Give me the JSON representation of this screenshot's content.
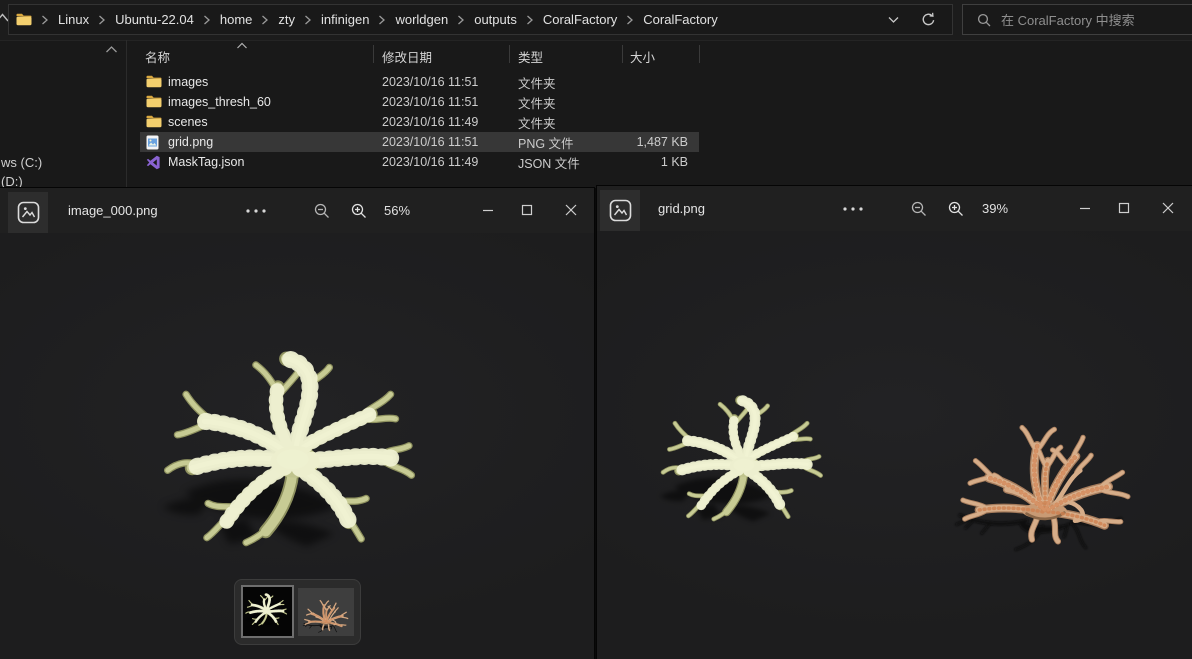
{
  "explorer": {
    "breadcrumb": [
      "Linux",
      "Ubuntu-22.04",
      "home",
      "zty",
      "infinigen",
      "worldgen",
      "outputs",
      "CoralFactory",
      "CoralFactory"
    ],
    "search_placeholder": "在 CoralFactory 中搜索",
    "nav_items": [
      "ws (C:)",
      "(D:)"
    ],
    "columns": {
      "name": "名称",
      "date": "修改日期",
      "type": "类型",
      "size": "大小"
    },
    "files": [
      {
        "name": "images",
        "date": "2023/10/16 11:51",
        "type": "文件夹",
        "size": "",
        "icon": "folder-icon",
        "selected": false
      },
      {
        "name": "images_thresh_60",
        "date": "2023/10/16 11:51",
        "type": "文件夹",
        "size": "",
        "icon": "folder-icon",
        "selected": false
      },
      {
        "name": "scenes",
        "date": "2023/10/16 11:49",
        "type": "文件夹",
        "size": "",
        "icon": "folder-icon",
        "selected": false
      },
      {
        "name": "grid.png",
        "date": "2023/10/16 11:51",
        "type": "PNG 文件",
        "size": "1,487 KB",
        "icon": "image-file-icon",
        "selected": true
      },
      {
        "name": "MaskTag.json",
        "date": "2023/10/16 11:49",
        "type": "JSON 文件",
        "size": "1 KB",
        "icon": "json-file-icon",
        "selected": false
      }
    ]
  },
  "viewer_left": {
    "title": "image_000.png",
    "zoom_level": "56%"
  },
  "viewer_right": {
    "title": "grid.png",
    "zoom_level": "39%"
  },
  "icons": {
    "breadcrumb_folder": "folder-icon",
    "search": "search-icon",
    "refresh": "refresh-icon",
    "chevron_down": "chevron-down-icon",
    "photos_app": "photos-app-icon",
    "more": "more-options-icon",
    "zoom_out": "zoom-out-icon",
    "zoom_in": "zoom-in-icon",
    "minimize": "minimize-icon",
    "maximize": "maximize-icon",
    "close": "close-icon"
  },
  "colors": {
    "folder_yellow": "#f3cf6e",
    "selection_bg": "#373737",
    "coral_green": "#ccd09b",
    "coral_tan": "#d7af8c",
    "viewer_bg": "#1e1e1f"
  }
}
